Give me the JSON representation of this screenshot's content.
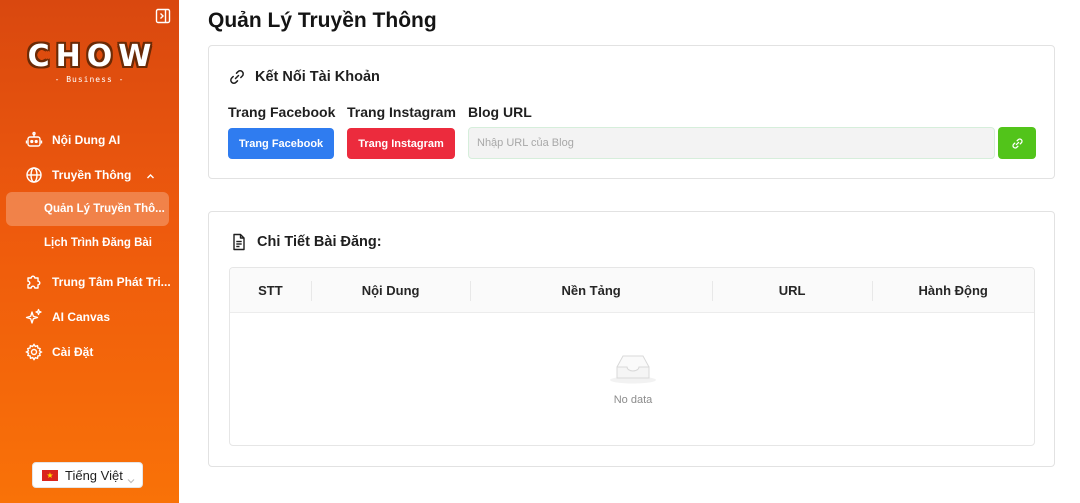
{
  "sidebar": {
    "logo": {
      "main": "CHOW",
      "sub": "- Business -"
    },
    "items": [
      {
        "label": "Nội Dung AI",
        "icon": "robot-icon"
      },
      {
        "label": "Truyền Thông",
        "icon": "globe-icon",
        "expanded": true,
        "children": [
          {
            "label": "Quản Lý Truyền Thô...",
            "active": true
          },
          {
            "label": "Lịch Trình Đăng Bài",
            "active": false
          }
        ]
      },
      {
        "label": "Trung Tâm Phát Tri...",
        "icon": "puzzle-icon"
      },
      {
        "label": "AI Canvas",
        "icon": "sparkle-icon"
      },
      {
        "label": "Cài Đặt",
        "icon": "gear-icon"
      }
    ],
    "language": {
      "label": "Tiếng Việt",
      "flag": "vietnam-flag-icon"
    }
  },
  "page": {
    "title": "Quản Lý Truyền Thông"
  },
  "connect": {
    "title": "Kết Nối Tài Khoản",
    "facebook_label": "Trang Facebook",
    "facebook_button": "Trang Facebook",
    "instagram_label": "Trang Instagram",
    "instagram_button": "Trang Instagram",
    "blog_label": "Blog URL",
    "blog_placeholder": "Nhập URL của Blog",
    "blog_value": ""
  },
  "posts": {
    "title": "Chi Tiết Bài Đăng:",
    "columns": [
      "STT",
      "Nội Dung",
      "Nền Tảng",
      "URL",
      "Hành Động"
    ],
    "rows": [],
    "empty_text": "No data"
  },
  "colors": {
    "sidebar_top": "#d9480f",
    "sidebar_bottom": "#f97208",
    "facebook": "#2f7cf0",
    "instagram": "#ec2b3d",
    "link_button": "#52c41a"
  }
}
